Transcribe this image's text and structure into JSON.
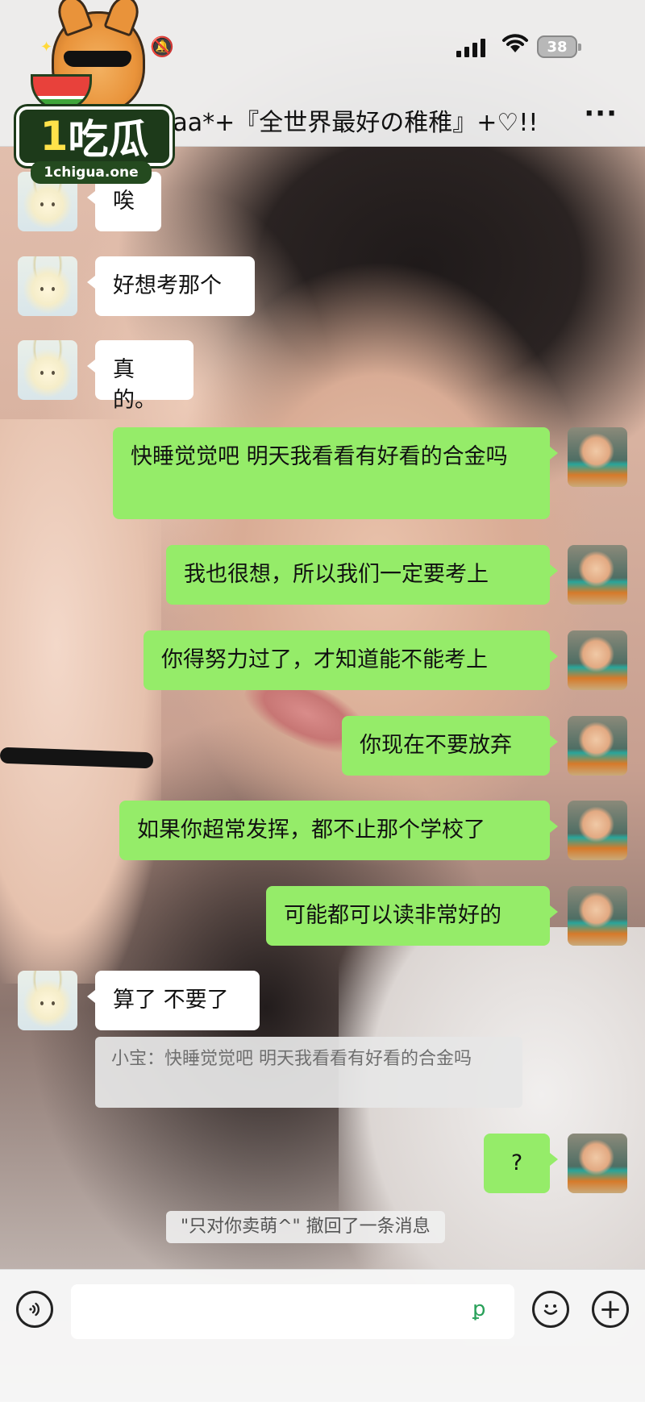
{
  "status_bar": {
    "time": "",
    "battery": "38"
  },
  "header": {
    "title": "aaa*+『全世界最好の稚稚』+♡!!",
    "more_icon": "more-icon"
  },
  "watermark": {
    "brand": "1吃瓜",
    "site": "1chigua.one"
  },
  "messages": [
    {
      "side": "left",
      "text": "唉"
    },
    {
      "side": "left",
      "text": "好想考那个"
    },
    {
      "side": "left",
      "text": "真的。"
    },
    {
      "side": "right",
      "text": "快睡觉觉吧 明天我看看有好看的合金吗"
    },
    {
      "side": "right",
      "text": "我也很想，所以我们一定要考上"
    },
    {
      "side": "right",
      "text": "你得努力过了，才知道能不能考上"
    },
    {
      "side": "right",
      "text": "你现在不要放弃"
    },
    {
      "side": "right",
      "text": "如果你超常发挥，都不止那个学校了"
    },
    {
      "side": "right",
      "text": "可能都可以读非常好的"
    },
    {
      "side": "left",
      "text": "算了 不要了"
    },
    {
      "side": "right",
      "text": "?"
    }
  ],
  "quote": {
    "text": "小宝：快睡觉觉吧 明天我看看有好看的合金吗"
  },
  "system_note": "\"只对你卖萌^\" 撤回了一条消息",
  "input": {
    "value": "",
    "placeholder": ""
  },
  "icons": {
    "voice": "voice-icon",
    "emoji": "emoji-icon",
    "plus": "plus-icon"
  }
}
